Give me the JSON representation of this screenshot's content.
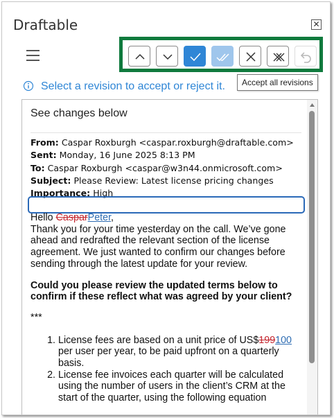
{
  "window": {
    "title": "Draftable",
    "close_glyph": "✕"
  },
  "toolbar": {
    "buttons": [
      {
        "name": "previous-revision-button",
        "icon": "chevron-up-icon"
      },
      {
        "name": "next-revision-button",
        "icon": "chevron-down-icon"
      },
      {
        "name": "accept-revision-button",
        "icon": "check-icon"
      },
      {
        "name": "accept-all-revisions-button",
        "icon": "double-check-icon"
      },
      {
        "name": "reject-revision-button",
        "icon": "x-icon"
      },
      {
        "name": "reject-all-revisions-button",
        "icon": "double-x-icon"
      },
      {
        "name": "undo-button",
        "icon": "undo-icon"
      }
    ],
    "tooltip": "Accept all revisions",
    "highlight_color": "#0f7a3d",
    "accent_color": "#2f86d6"
  },
  "info": {
    "text": "Select a revision to accept or reject it."
  },
  "document": {
    "heading": "See changes below",
    "headers": {
      "from_label": "From:",
      "from_value": "Caspar Roxburgh <caspar.roxburgh@draftable.com>",
      "sent_label": "Sent:",
      "sent_value": "Monday, 16 June 2025 8:13 PM",
      "to_label": "To:",
      "to_value": "Caspar Roxburgh <caspar@w3n44.onmicrosoft.com>",
      "subject_label": "Subject:",
      "subject_value": "Please Review: Latest license pricing changes",
      "importance_label": "Importance:",
      "importance_value": "High"
    },
    "greeting_prefix": "Hello ",
    "greeting_deleted": "Caspar",
    "greeting_inserted": "Peter",
    "greeting_suffix": ",",
    "paragraph": "Thank you for your time yesterday on the call. We’ve gone ahead and redrafted the relevant section of the license agreement. We just wanted to confirm our changes before sending through the latest update for your review.",
    "question": "Could you please review the updated terms below to confirm if these reflect what was agreed by your client?",
    "separator": "***",
    "item1_prefix": "License fees are based on a unit price of US$",
    "item1_deleted": "199",
    "item1_inserted": "100",
    "item1_suffix": " per user per year, to be paid upfront on a quarterly basis.",
    "item2": "License fee invoices each quarter will be calculated using the number of users in the client’s CRM at the start of the quarter, using the following equation"
  }
}
